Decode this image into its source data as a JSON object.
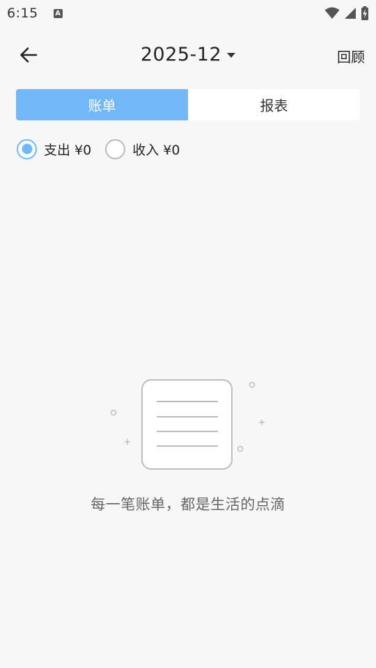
{
  "status_bar": {
    "time": "6:15",
    "notification_icon_letter": "A"
  },
  "header": {
    "month": "2025-12",
    "review_label": "回顾"
  },
  "tabs": [
    {
      "label": "账单",
      "active": true
    },
    {
      "label": "报表",
      "active": false
    }
  ],
  "filters": {
    "expense_label": "支出 ¥0",
    "income_label": "收入 ¥0",
    "selected": "expense"
  },
  "empty_state": {
    "message": "每一笔账单，都是生活的点滴"
  },
  "colors": {
    "accent": "#72b7f7",
    "background": "#f7f7f8"
  }
}
